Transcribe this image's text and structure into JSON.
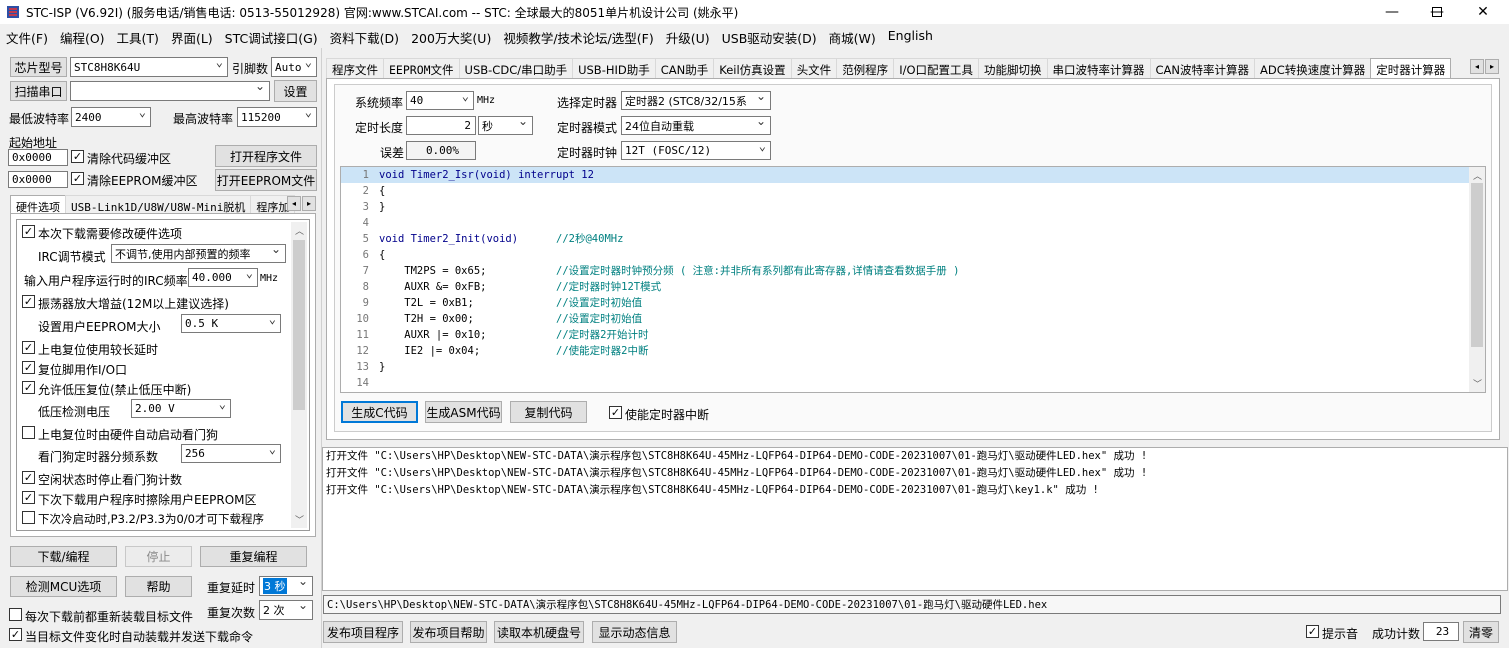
{
  "window": {
    "title": "STC-ISP (V6.92I) (服务电话/销售电话: 0513-55012928) 官网:www.STCAI.com  -- STC: 全球最大的8051单片机设计公司 (姚永平)"
  },
  "menu": [
    "文件(F)",
    "编程(O)",
    "工具(T)",
    "界面(L)",
    "STC调试接口(G)",
    "资料下载(D)",
    "200万大奖(U)",
    "视频教学/技术论坛/选型(F)",
    "升级(U)",
    "USB驱动安装(D)",
    "商城(W)",
    "English"
  ],
  "left": {
    "chip_label": "芯片型号",
    "chip_value": "STC8H8K64U",
    "pins_label": "引脚数",
    "pins_value": "Auto",
    "scan_port": "扫描串口",
    "port_value": "",
    "settings": "设置",
    "min_baud_label": "最低波特率",
    "min_baud": "2400",
    "max_baud_label": "最高波特率",
    "max_baud": "115200",
    "start_addr_label": "起始地址",
    "addr1": "0x0000",
    "clear_code": "清除代码缓冲区",
    "open_prog": "打开程序文件",
    "addr2": "0x0000",
    "clear_eeprom": "清除EEPROM缓冲区",
    "open_eeprom": "打开EEPROM文件",
    "tabs": [
      "硬件选项",
      "USB-Link1D/U8W/U8W-Mini脱机",
      "程序加"
    ],
    "options": {
      "o1": "本次下载需要修改硬件选项",
      "irc_mode_label": "IRC调节模式",
      "irc_mode_value": "不调节,使用内部预置的频率",
      "irc_freq_label": "输入用户程序运行时的IRC频率",
      "irc_freq_value": "40.000",
      "irc_freq_unit": "MHz",
      "o2": "振荡器放大增益(12M以上建议选择)",
      "eeprom_label": "设置用户EEPROM大小",
      "eeprom_value": "0.5 K",
      "o3": "上电复位使用较长延时",
      "o4": "复位脚用作I/O口",
      "o5": "允许低压复位(禁止低压中断)",
      "lvd_label": "低压检测电压",
      "lvd_value": "2.00 V",
      "o6": "上电复位时由硬件自动启动看门狗",
      "wdt_label": "看门狗定时器分频系数",
      "wdt_value": "256",
      "o7": "空闲状态时停止看门狗计数",
      "o8": "下次下载用户程序时擦除用户EEPROM区",
      "o9": "下次冷启动时,P3.2/P3.3为0/0才可下载程序"
    },
    "download": "下载/编程",
    "stop": "停止",
    "reprog": "重复编程",
    "detect": "检测MCU选项",
    "help": "帮助",
    "repeat_delay_label": "重复延时",
    "repeat_delay_value": "3 秒",
    "repeat_count_label": "重复次数",
    "repeat_count_value": "2 次",
    "reload_each": "每次下载前都重新装载目标文件",
    "auto_send": "当目标文件变化时自动装载并发送下载命令"
  },
  "right": {
    "tabs": [
      "程序文件",
      "EEPROM文件",
      "USB-CDC/串口助手",
      "USB-HID助手",
      "CAN助手",
      "Keil仿真设置",
      "头文件",
      "范例程序",
      "I/O口配置工具",
      "功能脚切换",
      "串口波特率计算器",
      "CAN波特率计算器",
      "ADC转换速度计算器",
      "定时器计算器"
    ],
    "sys_freq_label": "系统频率",
    "sys_freq_value": "40",
    "sys_freq_unit": "MHz",
    "timer_sel_label": "选择定时器",
    "timer_sel_value": "定时器2 (STC8/32/15系",
    "len_label": "定时长度",
    "len_value": "2",
    "len_unit": "秒",
    "mode_label": "定时器模式",
    "mode_value": "24位自动重载",
    "err_label": "误差",
    "err_value": "0.00%",
    "clock_label": "定时器时钟",
    "clock_value": "12T (FOSC/12)",
    "gen_c": "生成C代码",
    "gen_asm": "生成ASM代码",
    "copy": "复制代码",
    "enable_int": "使能定时器中断",
    "code": [
      {
        "n": "1",
        "code": "void Timer2_Isr(void) interrupt 12",
        "comment": ""
      },
      {
        "n": "2",
        "code": "{",
        "comment": ""
      },
      {
        "n": "3",
        "code": "}",
        "comment": ""
      },
      {
        "n": "4",
        "code": "",
        "comment": ""
      },
      {
        "n": "5",
        "code": "void Timer2_Init(void)      ",
        "comment": "//2秒@40MHz"
      },
      {
        "n": "6",
        "code": "{",
        "comment": ""
      },
      {
        "n": "7",
        "code": "    TM2PS = 0x65;           ",
        "comment": "//设置定时器时钟预分频 ( 注意:并非所有系列都有此寄存器,详情请查看数据手册 )"
      },
      {
        "n": "8",
        "code": "    AUXR &= 0xFB;           ",
        "comment": "//定时器时钟12T模式"
      },
      {
        "n": "9",
        "code": "    T2L = 0xB1;             ",
        "comment": "//设置定时初始值"
      },
      {
        "n": "10",
        "code": "    T2H = 0x00;             ",
        "comment": "//设置定时初始值"
      },
      {
        "n": "11",
        "code": "    AUXR |= 0x10;           ",
        "comment": "//定时器2开始计时"
      },
      {
        "n": "12",
        "code": "    IE2 |= 0x04;            ",
        "comment": "//使能定时器2中断"
      },
      {
        "n": "13",
        "code": "}",
        "comment": ""
      },
      {
        "n": "14",
        "code": "",
        "comment": ""
      }
    ],
    "log": [
      "打开文件 \"C:\\Users\\HP\\Desktop\\NEW-STC-DATA\\演示程序包\\STC8H8K64U-45MHz-LQFP64-DIP64-DEMO-CODE-20231007\\01-跑马灯\\驱动硬件LED.hex\" 成功 !",
      "打开文件 \"C:\\Users\\HP\\Desktop\\NEW-STC-DATA\\演示程序包\\STC8H8K64U-45MHz-LQFP64-DIP64-DEMO-CODE-20231007\\01-跑马灯\\驱动硬件LED.hex\" 成功 !",
      "打开文件 \"C:\\Users\\HP\\Desktop\\NEW-STC-DATA\\演示程序包\\STC8H8K64U-45MHz-LQFP64-DIP64-DEMO-CODE-20231007\\01-跑马灯\\key1.k\" 成功 !"
    ],
    "path": "C:\\Users\\HP\\Desktop\\NEW-STC-DATA\\演示程序包\\STC8H8K64U-45MHz-LQFP64-DIP64-DEMO-CODE-20231007\\01-跑马灯\\驱动硬件LED.hex",
    "publish_proj": "发布项目程序",
    "publish_help": "发布项目帮助",
    "read_disk": "读取本机硬盘号",
    "show_dyn": "显示动态信息",
    "sound": "提示音",
    "success_label": "成功计数",
    "success_value": "23",
    "clear": "清零"
  }
}
